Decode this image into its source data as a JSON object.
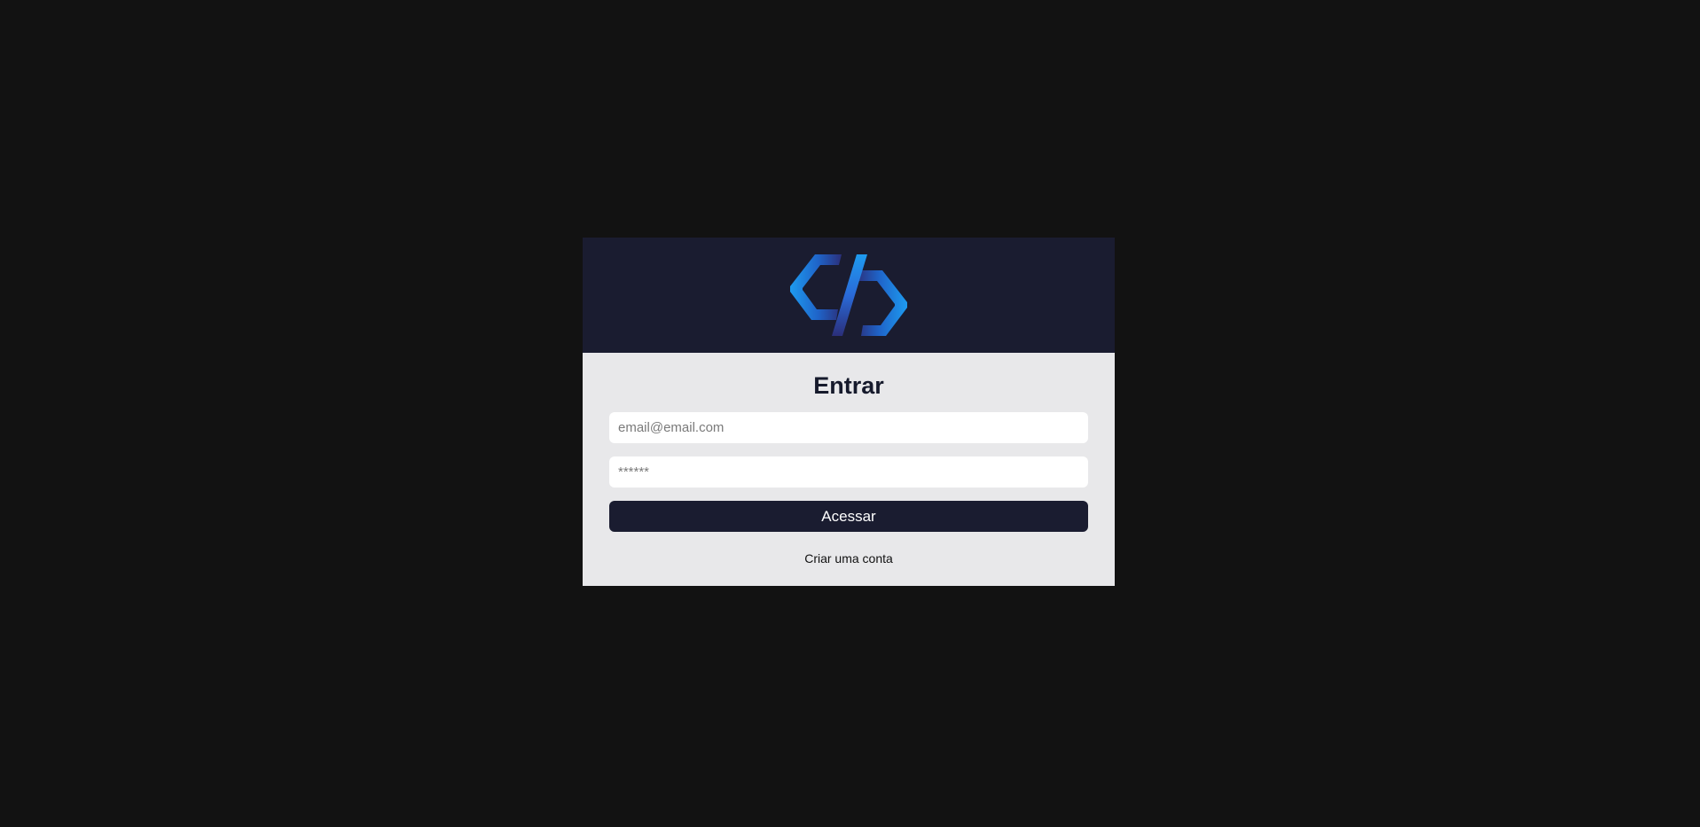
{
  "page": {
    "background": "#121212"
  },
  "header": {
    "background": "#1a1c30",
    "logo_icon": "code-brackets-logo-icon"
  },
  "form": {
    "title": "Entrar",
    "email_placeholder": "email@email.com",
    "email_value": "",
    "password_placeholder": "******",
    "password_value": "",
    "submit_label": "Acessar",
    "signup_link": "Criar uma conta"
  },
  "colors": {
    "accent": "#1a1c30",
    "logo_light": "#1e9bf0",
    "logo_dark": "#2b2f7a",
    "card_body": "#e8e8ea"
  }
}
